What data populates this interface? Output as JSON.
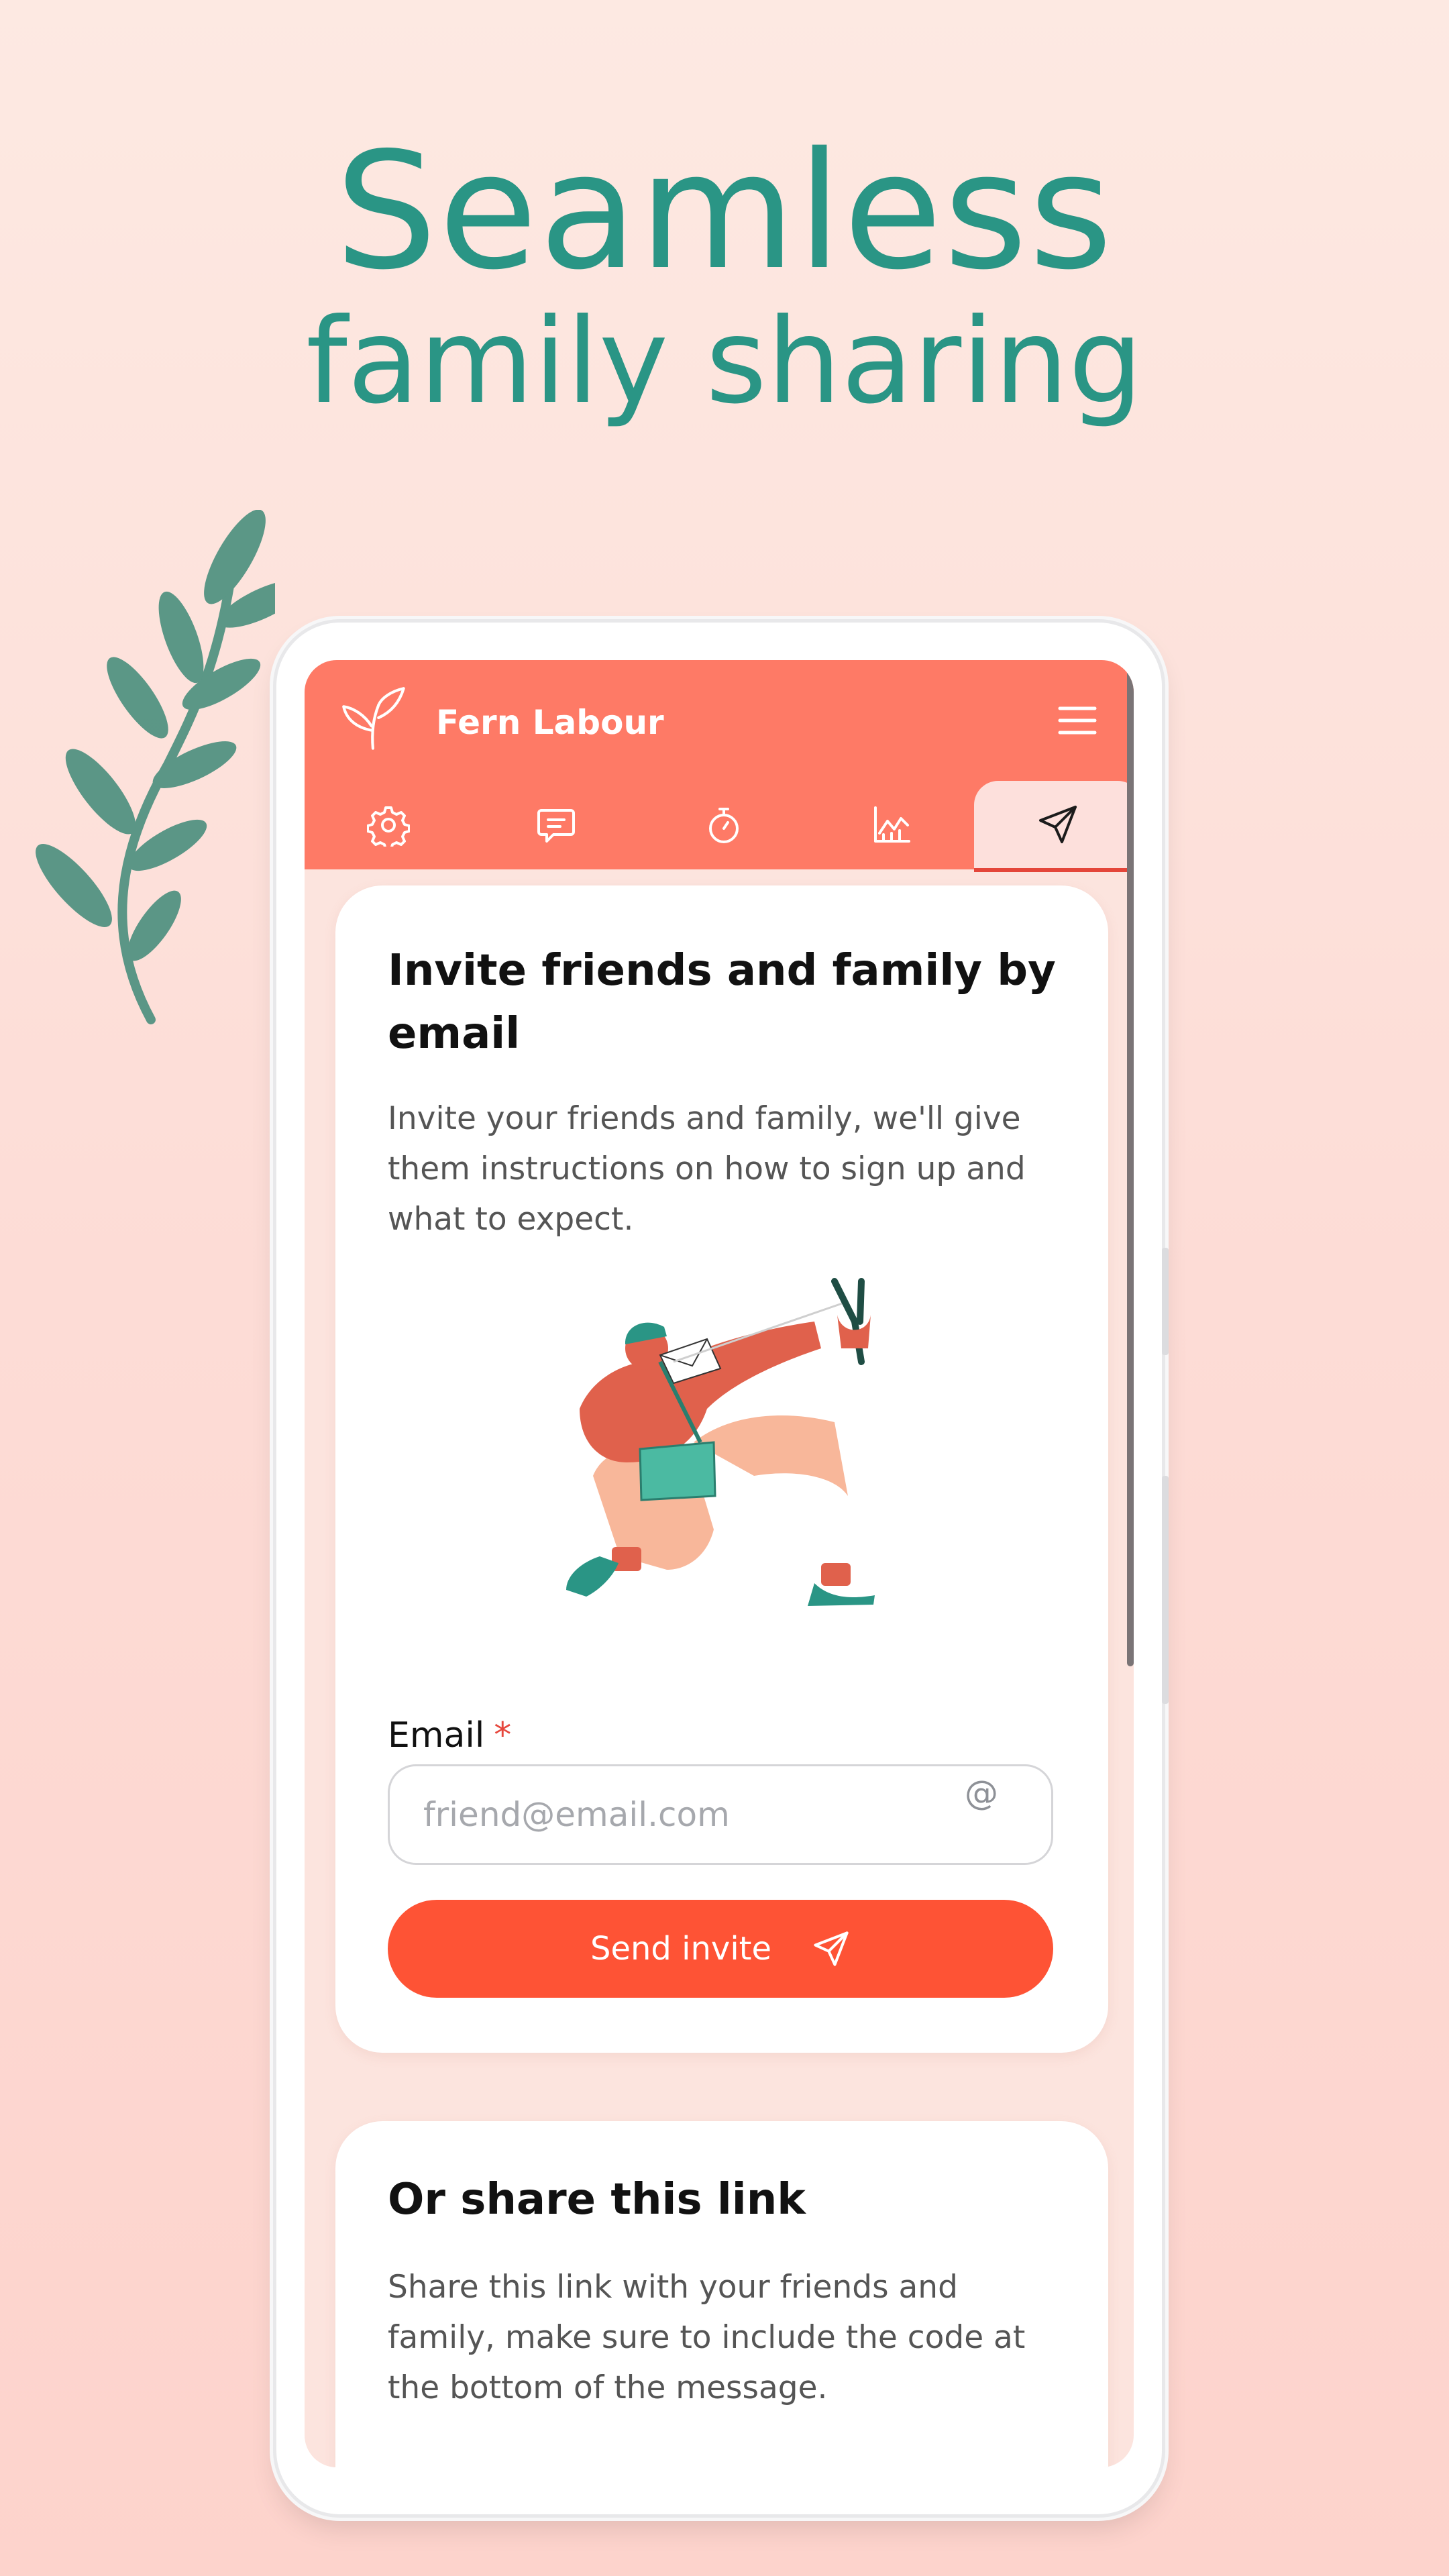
{
  "hero": {
    "line1": "Seamless",
    "line2": "family sharing"
  },
  "app": {
    "title": "Fern Labour"
  },
  "tabs": [
    {
      "name": "settings",
      "icon": "gear-icon"
    },
    {
      "name": "contractions-chat",
      "icon": "message-icon"
    },
    {
      "name": "timer",
      "icon": "stopwatch-icon"
    },
    {
      "name": "stats",
      "icon": "chart-icon"
    },
    {
      "name": "share",
      "icon": "send-icon",
      "active": true
    }
  ],
  "invite_card": {
    "title": "Invite friends and family by email",
    "description": "Invite your friends and family, we'll give them instructions on how to sign up and what to expect.",
    "email_label": "Email",
    "required_mark": "*",
    "email_placeholder": "friend@email.com",
    "email_value": "",
    "button_label": "Send invite"
  },
  "share_card": {
    "title": "Or share this link",
    "description": "Share this link with your friends and family, make sure to include the code at the bottom of the message."
  },
  "colors": {
    "brand": "#fe7a66",
    "button": "#fe5335",
    "headline": "#2a9585",
    "active_tab_underline": "#e4463a"
  }
}
